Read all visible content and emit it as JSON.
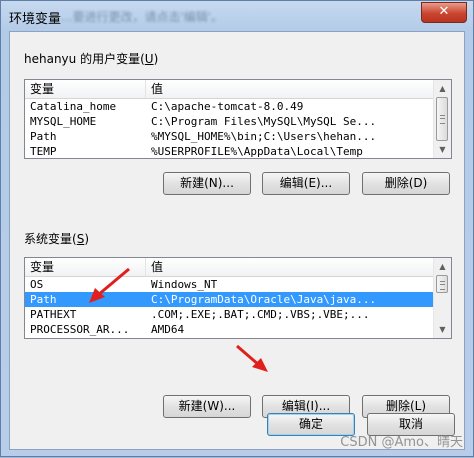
{
  "window": {
    "title": "环境变量",
    "title_faded": "...要进行更改，请点击'编辑'。",
    "close_label": "✕"
  },
  "user_vars": {
    "label_prefix": "hehanyu 的用户变量(",
    "label_key": "U",
    "label_suffix": ")",
    "columns": [
      "变量",
      "值"
    ],
    "rows": [
      {
        "name": "Catalina_home",
        "value": "C:\\apache-tomcat-8.0.49"
      },
      {
        "name": "MYSQL_HOME",
        "value": "C:\\Program Files\\MySQL\\MySQL Se..."
      },
      {
        "name": "Path",
        "value": "%MYSQL_HOME%\\bin;C:\\Users\\hehan..."
      },
      {
        "name": "TEMP",
        "value": "%USERPROFILE%\\AppData\\Local\\Temp"
      }
    ],
    "buttons": {
      "new": "新建(N)...",
      "edit": "编辑(E)...",
      "delete": "删除(D)"
    }
  },
  "system_vars": {
    "label_prefix": "系统变量(",
    "label_key": "S",
    "label_suffix": ")",
    "columns": [
      "变量",
      "值"
    ],
    "rows": [
      {
        "name": "OS",
        "value": "Windows_NT"
      },
      {
        "name": "Path",
        "value": "C:\\ProgramData\\Oracle\\Java\\java..."
      },
      {
        "name": "PATHEXT",
        "value": ".COM;.EXE;.BAT;.CMD;.VBS;.VBE;..."
      },
      {
        "name": "PROCESSOR_AR...",
        "value": "AMD64"
      }
    ],
    "selected_row": 1,
    "buttons": {
      "new": "新建(W)...",
      "edit": "编辑(I)...",
      "delete": "删除(L)"
    }
  },
  "dialog_buttons": {
    "ok": "确定",
    "cancel": "取消"
  },
  "watermark": "CSDN @Amo、晴天",
  "colors": {
    "selection": "#3399ff",
    "annotation_arrow": "#e0201c",
    "close_button": "#c9452f"
  },
  "icons": {
    "close": "close-icon",
    "scroll_up": "chevron-up-icon",
    "scroll_down": "chevron-down-icon"
  }
}
